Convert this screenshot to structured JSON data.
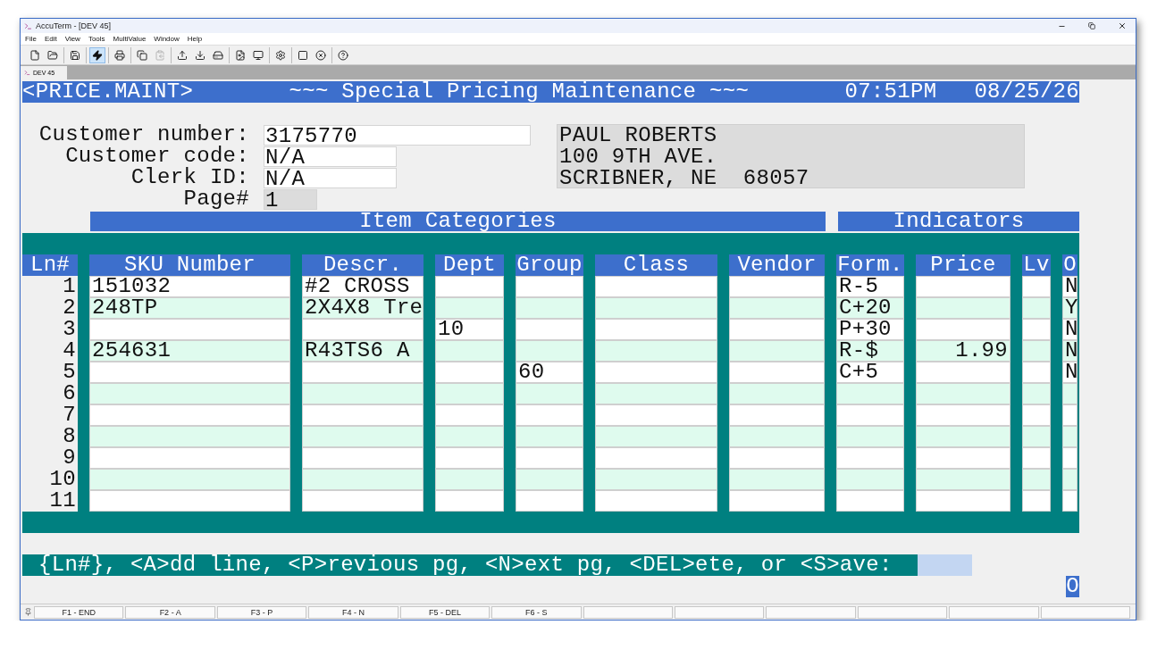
{
  "window": {
    "title": "AccuTerm - [DEV 45]"
  },
  "menu": [
    "File",
    "Edit",
    "View",
    "Tools",
    "MultiValue",
    "Window",
    "Help"
  ],
  "toolbar": [
    [
      {
        "kind": "new",
        "selected": false,
        "disabled": false
      },
      {
        "kind": "open",
        "selected": false,
        "disabled": false
      }
    ],
    [
      {
        "kind": "save",
        "selected": false,
        "disabled": false
      }
    ],
    [
      {
        "kind": "bolt",
        "selected": true,
        "disabled": false
      }
    ],
    [
      {
        "kind": "print",
        "selected": false,
        "disabled": false
      }
    ],
    [
      {
        "kind": "copy",
        "selected": false,
        "disabled": false
      },
      {
        "kind": "paste",
        "selected": false,
        "disabled": true
      }
    ],
    [
      {
        "kind": "upload",
        "selected": false,
        "disabled": false
      },
      {
        "kind": "download",
        "selected": false,
        "disabled": false
      },
      {
        "kind": "drive",
        "selected": false,
        "disabled": false
      }
    ],
    [
      {
        "kind": "document",
        "selected": false,
        "disabled": false
      },
      {
        "kind": "screen",
        "selected": false,
        "disabled": false
      }
    ],
    [
      {
        "kind": "gear",
        "selected": false,
        "disabled": false
      }
    ],
    [
      {
        "kind": "square",
        "selected": false,
        "disabled": false
      },
      {
        "kind": "cancel",
        "selected": false,
        "disabled": false
      }
    ],
    [
      {
        "kind": "help",
        "selected": false,
        "disabled": false
      }
    ]
  ],
  "tabs": [
    {
      "label": "DEV 45",
      "selected": true
    }
  ],
  "header": {
    "program": "<PRICE.MAINT>",
    "title": "~~~ Special Pricing Maintenance ~~~",
    "time": "07:51PM",
    "date": "08/25/26"
  },
  "customer": {
    "fields": [
      {
        "label": "Customer number:",
        "value": "3175770",
        "kind": "long"
      },
      {
        "label": "Customer code:",
        "value": "N/A",
        "kind": "medium"
      },
      {
        "label": "Clerk ID:",
        "value": "N/A",
        "kind": "medium"
      },
      {
        "label": "Page#",
        "value": "1",
        "kind": "short"
      }
    ],
    "address": [
      "PAUL ROBERTS",
      "100 9TH AVE.",
      "SCRIBNER, NE  68057"
    ]
  },
  "sections": {
    "categories": "Item Categories",
    "indicators": "Indicators"
  },
  "table": {
    "columns": [
      {
        "label": "Ln#",
        "kind": "line"
      },
      {
        "label": "SKU Number",
        "kind": "text"
      },
      {
        "label": "Descr.",
        "kind": "text"
      },
      {
        "label": "Dept",
        "kind": "text"
      },
      {
        "label": "Group",
        "kind": "text"
      },
      {
        "label": "Class",
        "kind": "text"
      },
      {
        "label": "Vendor",
        "kind": "text"
      },
      {
        "label": "Form.",
        "kind": "text"
      },
      {
        "label": "Price",
        "kind": "amount"
      },
      {
        "label": "Lv",
        "kind": "text"
      },
      {
        "label": "O",
        "kind": "text"
      }
    ],
    "rows": [
      [
        "1",
        "151032",
        "#2 CROSS",
        null,
        null,
        null,
        null,
        "R-5",
        null,
        null,
        "N"
      ],
      [
        "2",
        "248TP",
        "2X4X8 Tre",
        null,
        null,
        null,
        null,
        "C+20",
        null,
        null,
        "Y"
      ],
      [
        "3",
        null,
        null,
        "10",
        null,
        null,
        null,
        "P+30",
        null,
        null,
        "N"
      ],
      [
        "4",
        "254631",
        "R43TS6 A",
        null,
        null,
        null,
        null,
        "R-$",
        "1.99",
        null,
        "N"
      ],
      [
        "5",
        null,
        null,
        null,
        "60",
        null,
        null,
        "C+5",
        null,
        null,
        "N"
      ],
      [
        "6"
      ],
      [
        "7"
      ],
      [
        "8"
      ],
      [
        "9"
      ],
      [
        "10"
      ],
      [
        "11"
      ]
    ]
  },
  "prompt": "{Ln#}, <A>dd line, <P>revious pg, <N>ext pg, <DEL>ete, or <S>ave:",
  "cursor": "O",
  "function_keys": [
    "F1 - END",
    "F2 - A",
    "F3 - P",
    "F4 - N",
    "F5 - DEL",
    "F6 - S"
  ]
}
